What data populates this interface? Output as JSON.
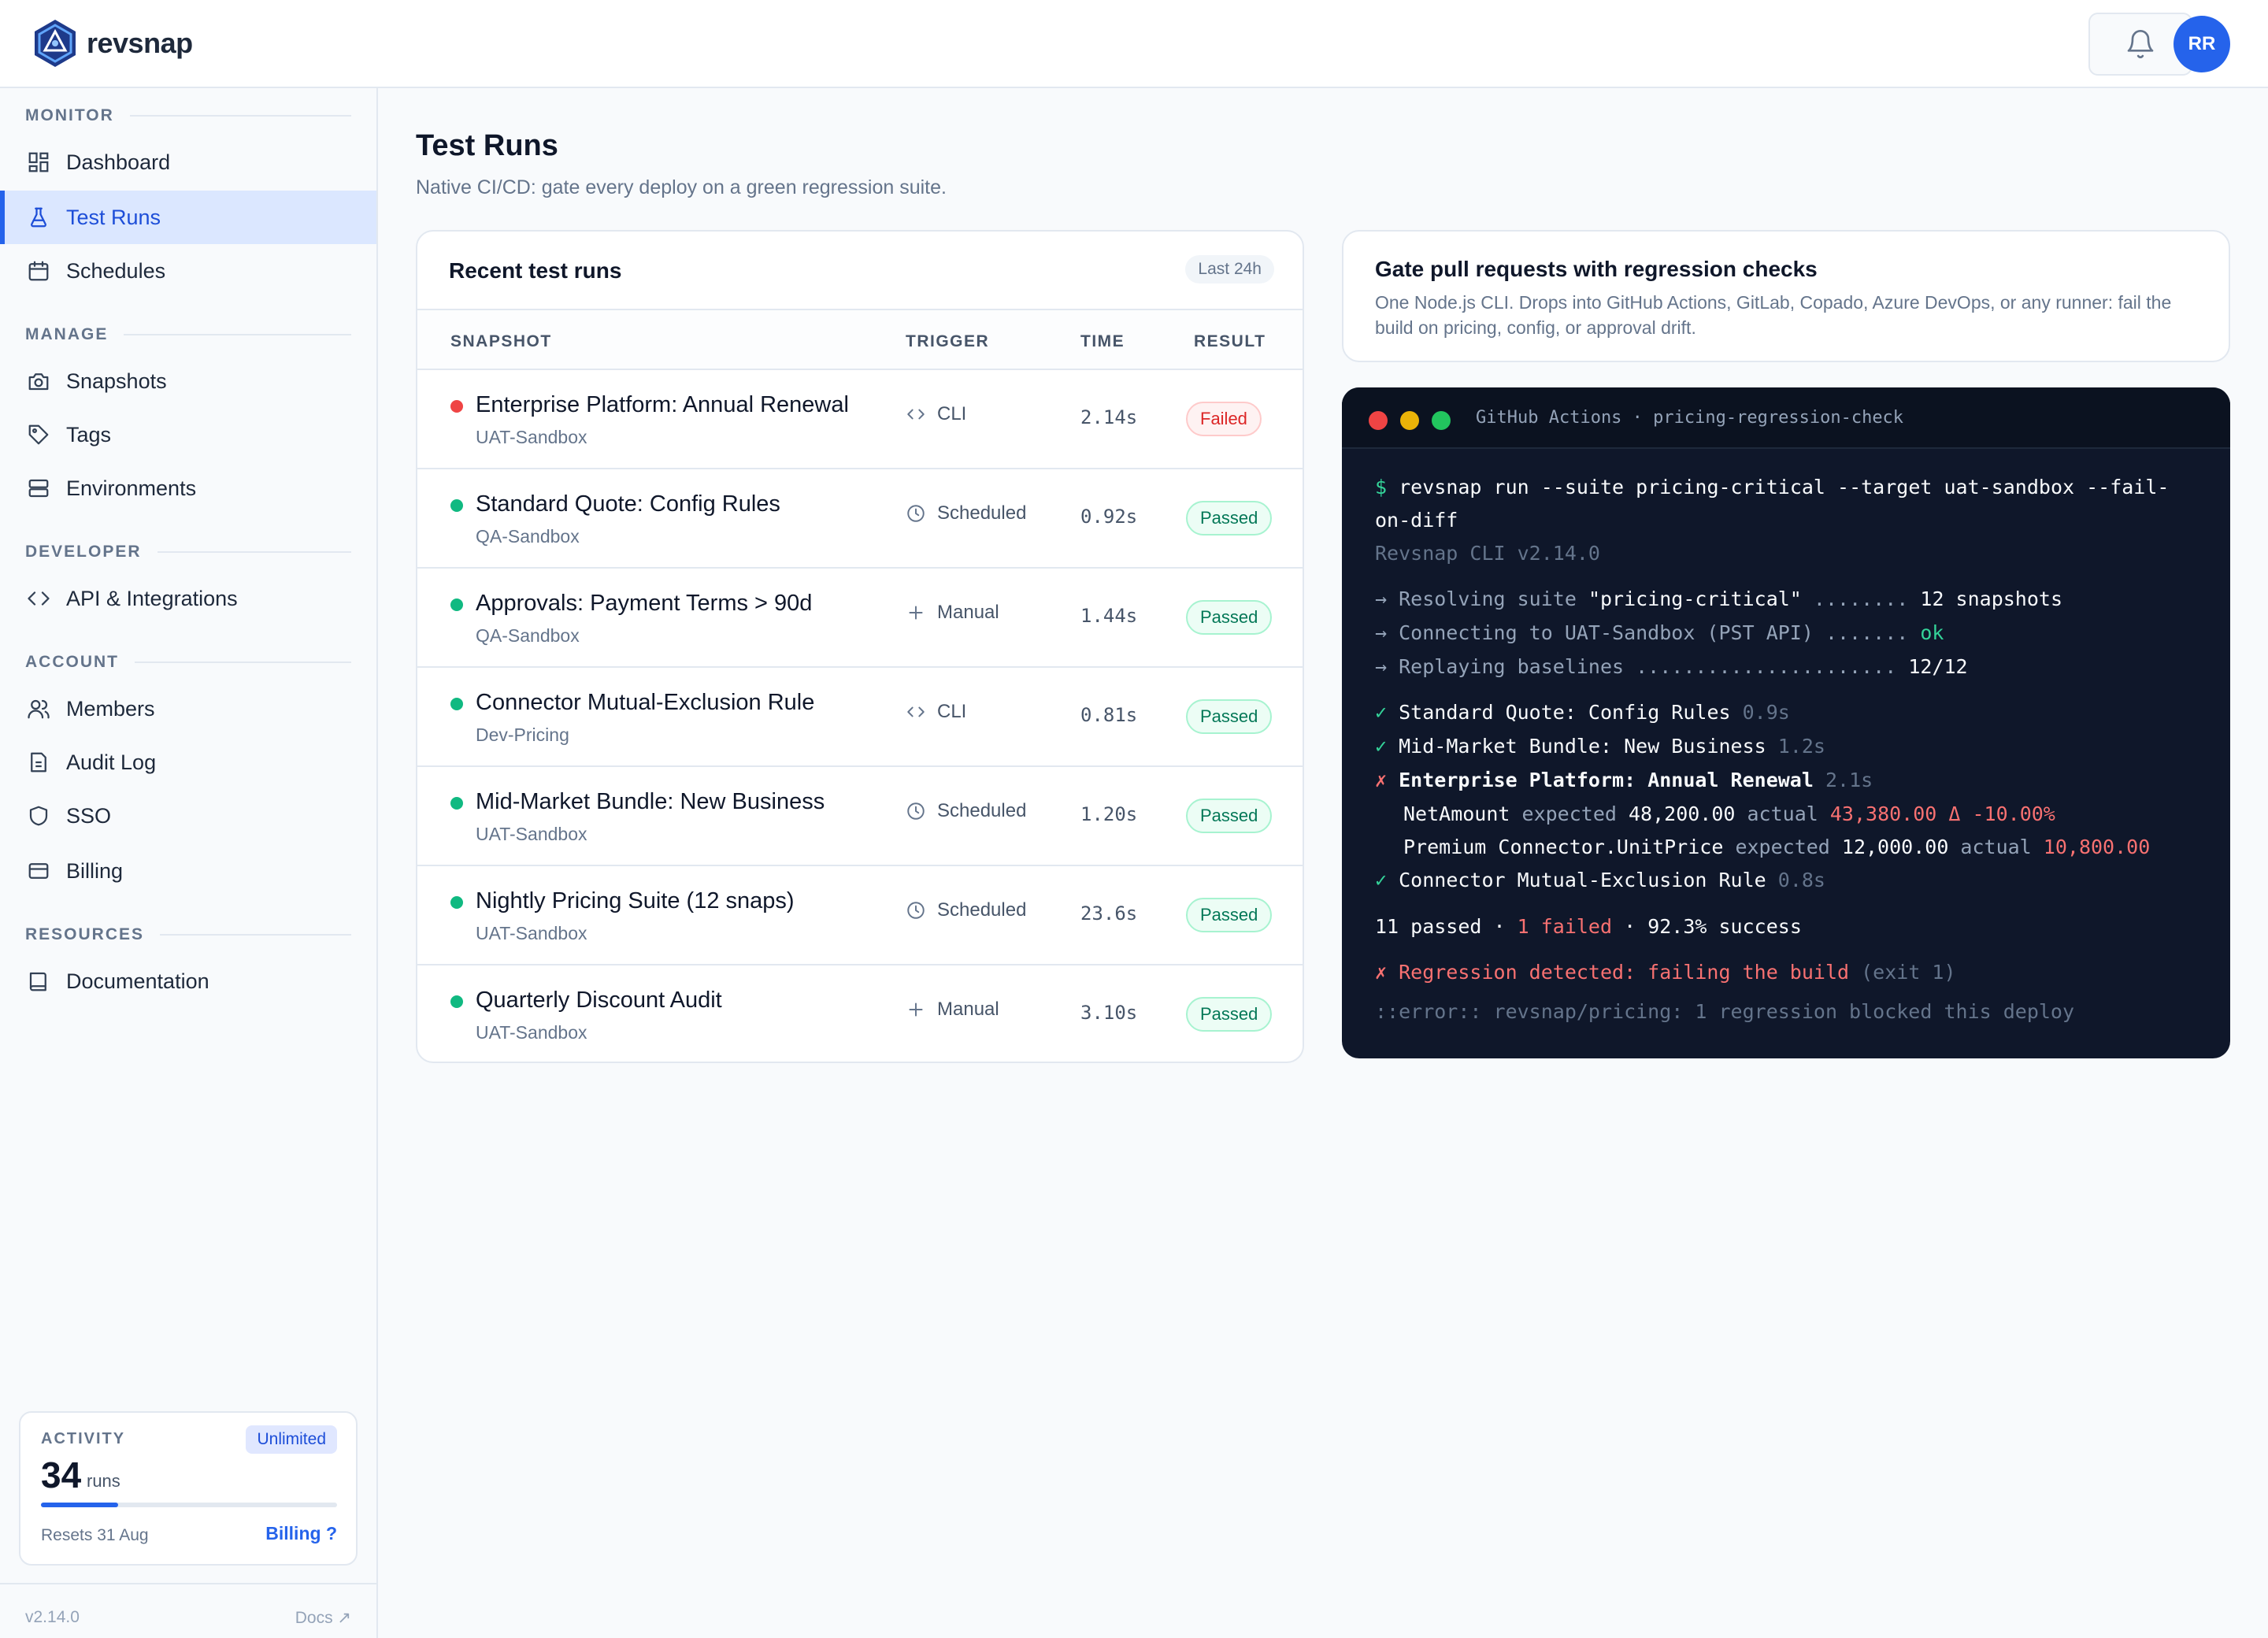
{
  "app": {
    "name": "revsnap"
  },
  "header": {
    "avatar_initials": "RR",
    "bell_icon": "bell-icon",
    "brand_color": "#2563eb"
  },
  "sidebar": {
    "sections": {
      "monitor": "MONITOR",
      "manage": "MANAGE",
      "developer": "DEVELOPER",
      "account": "ACCOUNT",
      "resources": "RESOURCES"
    },
    "items": {
      "dashboard": "Dashboard",
      "test_runs": "Test Runs",
      "schedules": "Schedules",
      "snapshots": "Snapshots",
      "tags": "Tags",
      "environments": "Environments",
      "api": "API & Integrations",
      "members": "Members",
      "audit_log": "Audit Log",
      "sso": "SSO",
      "billing": "Billing",
      "documentation": "Documentation"
    },
    "active": "test_runs",
    "usage": {
      "label": "ACTIVITY",
      "badge": "Unlimited",
      "count": "34",
      "unit": "runs",
      "progress_fraction": 0.26,
      "reset": "Resets 31 Aug",
      "billing_link": "Billing ?"
    },
    "footer": {
      "version": "v2.14.0",
      "docs": "Docs ↗"
    }
  },
  "page": {
    "title": "Test Runs",
    "subtitle": "Native CI/CD: gate every deploy on a green regression suite."
  },
  "runs": {
    "title": "Recent test runs",
    "range": "Last 24h",
    "columns": {
      "snapshot": "SNAPSHOT",
      "trigger": "TRIGGER",
      "time": "TIME",
      "result": "RESULT"
    },
    "rows": [
      {
        "name": "Enterprise Platform: Annual Renewal",
        "env": "UAT-Sandbox",
        "trigger": "CLI",
        "trigger_icon": "code-icon",
        "time": "2.14s",
        "result": "Failed",
        "status": "failed"
      },
      {
        "name": "Standard Quote: Config Rules",
        "env": "QA-Sandbox",
        "trigger": "Scheduled",
        "trigger_icon": "clock-icon",
        "time": "0.92s",
        "result": "Passed",
        "status": "passed"
      },
      {
        "name": "Approvals: Payment Terms > 90d",
        "env": "QA-Sandbox",
        "trigger": "Manual",
        "trigger_icon": "plus-icon",
        "time": "1.44s",
        "result": "Passed",
        "status": "passed"
      },
      {
        "name": "Connector Mutual-Exclusion Rule",
        "env": "Dev-Pricing",
        "trigger": "CLI",
        "trigger_icon": "code-icon",
        "time": "0.81s",
        "result": "Passed",
        "status": "passed"
      },
      {
        "name": "Mid-Market Bundle: New Business",
        "env": "UAT-Sandbox",
        "trigger": "Scheduled",
        "trigger_icon": "clock-icon",
        "time": "1.20s",
        "result": "Passed",
        "status": "passed"
      },
      {
        "name": "Nightly Pricing Suite (12 snaps)",
        "env": "UAT-Sandbox",
        "trigger": "Scheduled",
        "trigger_icon": "clock-icon",
        "time": "23.6s",
        "result": "Passed",
        "status": "passed"
      },
      {
        "name": "Quarterly Discount Audit",
        "env": "UAT-Sandbox",
        "trigger": "Manual",
        "trigger_icon": "plus-icon",
        "time": "3.10s",
        "result": "Passed",
        "status": "passed"
      }
    ]
  },
  "gate": {
    "title": "Gate pull requests with regression checks",
    "description": "One Node.js CLI. Drops into GitHub Actions, GitLab, Copado, Azure DevOps, or any runner: fail the build on pricing, config, or approval drift."
  },
  "terminal": {
    "title": "GitHub Actions · pricing-regression-check",
    "prompt": "$",
    "command_1": "revsnap run --suite pricing-critical --target uat-sandbox --fail-",
    "command_2": "on-diff",
    "version": "Revsnap CLI v2.14.0",
    "l1_a": "→ Resolving suite ",
    "l1_b": "\"pricing-critical\"",
    "l1_c": " ........ ",
    "l1_d": "12 snapshots",
    "l2_a": "→ Connecting to UAT-Sandbox (PST API) ....... ",
    "l2_b": "ok",
    "l3_a": "→ Replaying baselines ...................... ",
    "l3_b": "12/12",
    "r1_mark": "✓",
    "r1_name": " Standard Quote: Config Rules ",
    "r1_time": "0.9s",
    "r2_mark": "✓",
    "r2_name": " Mid-Market Bundle: New Business ",
    "r2_time": "1.2s",
    "r3_mark": "✗",
    "r3_name": " Enterprise Platform: Annual Renewal ",
    "r3_time": "2.1s",
    "d1_field": "NetAmount",
    "d1_exp_l": " expected ",
    "d1_exp": "48,200.00",
    "d1_act_l": " actual ",
    "d1_act": "43,380.00 Δ -10.00%",
    "d2_field": "Premium Connector.UnitPrice",
    "d2_exp_l": " expected ",
    "d2_exp": "12,000.00",
    "d2_act_l": " actual ",
    "d2_act": "10,800.00",
    "r4_mark": "✓",
    "r4_name": " Connector Mutual-Exclusion Rule ",
    "r4_time": "0.8s",
    "sum_a": "11 passed · ",
    "sum_b": "1 failed",
    "sum_c": " · 92.3% success",
    "err_a": "✗ Regression detected: failing the build",
    "err_b": " (exit 1)",
    "err_line": "::error:: revsnap/pricing: 1 regression blocked this deploy"
  }
}
